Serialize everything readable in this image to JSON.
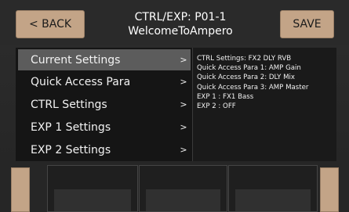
{
  "header": {
    "back_label": "< BACK",
    "title_line1": "CTRL/EXP: P01-1",
    "title_line2": "WelcomeToAmpero",
    "save_label": "SAVE"
  },
  "menu": {
    "items": [
      {
        "label": "Current Settings",
        "chevron": ">"
      },
      {
        "label": "Quick Access Para",
        "chevron": ">"
      },
      {
        "label": "CTRL Settings",
        "chevron": ">"
      },
      {
        "label": "EXP 1 Settings",
        "chevron": ">"
      },
      {
        "label": "EXP 2 Settings",
        "chevron": ">"
      }
    ]
  },
  "info": {
    "lines": [
      "CTRL Settings: FX2 DLY RVB",
      "Quick Access Para 1: AMP Gain",
      "Quick Access Para 2: DLY Mix",
      "Quick Access Para 3: AMP Master",
      "EXP 1 : FX1 Bass",
      "EXP 2 : OFF"
    ]
  },
  "colors": {
    "accent": "#c3a487",
    "active_row": "#5c5c5c",
    "background": "#2a2a2a"
  }
}
